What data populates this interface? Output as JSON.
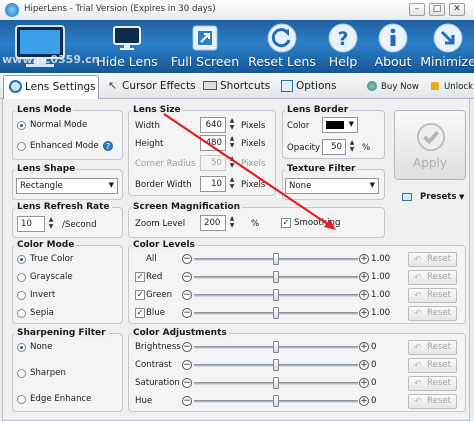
{
  "window": {
    "title": "HiperLens - Trial Version (Expires in 30 days)",
    "minimize": "–",
    "maximize": "□",
    "close": "✕"
  },
  "watermark": "www.pc0359.cn",
  "toolbar": {
    "hide_lens": "Hide Lens",
    "full_screen": "Full Screen",
    "reset_lens": "Reset Lens",
    "help": "Help",
    "about": "About",
    "minimize": "Minimize"
  },
  "tabs": {
    "lens_settings": "Lens Settings",
    "cursor_effects": "Cursor Effects",
    "shortcuts": "Shortcuts",
    "options": "Options",
    "buy_now": "Buy Now",
    "unlock": "Unlock"
  },
  "lens_mode": {
    "title": "Lens Mode",
    "normal": "Normal Mode",
    "enhanced": "Enhanced Mode",
    "selected": "normal"
  },
  "lens_size": {
    "title": "Lens Size",
    "width_label": "Width",
    "width_value": "640",
    "width_unit": "Pixels",
    "height_label": "Height",
    "height_value": "480",
    "height_unit": "Pixels",
    "corner_label": "Corner Radius",
    "corner_value": "50",
    "corner_unit": "Pixels",
    "border_label": "Border Width",
    "border_value": "10",
    "border_unit": "Pixels"
  },
  "lens_border": {
    "title": "Lens Border",
    "color_label": "Color",
    "color_value": "#000000",
    "opacity_label": "Opacity",
    "opacity_value": "50",
    "opacity_unit": "%"
  },
  "apply": {
    "label": "Apply"
  },
  "presets": {
    "label": "Presets"
  },
  "lens_shape": {
    "title": "Lens Shape",
    "value": "Rectangle"
  },
  "texture_filter": {
    "title": "Texture Filter",
    "value": "None"
  },
  "refresh_rate": {
    "title": "Lens Refresh Rate",
    "value": "10",
    "unit": "/Second"
  },
  "screen_mag": {
    "title": "Screen Magnification",
    "zoom_label": "Zoom Level",
    "zoom_value": "200",
    "zoom_unit": "%",
    "smoothing_label": "Smoothing",
    "smoothing_checked": true
  },
  "color_mode": {
    "title": "Color Mode",
    "items": [
      "True Color",
      "Grayscale",
      "Invert",
      "Sepia"
    ],
    "selected": 0
  },
  "color_levels": {
    "title": "Color Levels",
    "rows": [
      {
        "label": "All",
        "value": "1.00",
        "level": 0.5,
        "checkbox": false
      },
      {
        "label": "Red",
        "value": "1.00",
        "level": 0.5,
        "checkbox": true
      },
      {
        "label": "Green",
        "value": "1.00",
        "level": 0.5,
        "checkbox": true
      },
      {
        "label": "Blue",
        "value": "1.00",
        "level": 0.5,
        "checkbox": true
      }
    ],
    "reset_label": "Reset"
  },
  "sharpening": {
    "title": "Sharpening Filter",
    "items": [
      "None",
      "Sharpen",
      "Edge Enhance"
    ],
    "selected": 0
  },
  "color_adjust": {
    "title": "Color Adjustments",
    "rows": [
      {
        "label": "Brightness",
        "value": "0",
        "level": 0.5
      },
      {
        "label": "Contrast",
        "value": "0",
        "level": 0.5
      },
      {
        "label": "Saturation",
        "value": "0",
        "level": 0.5
      },
      {
        "label": "Hue",
        "value": "0",
        "level": 0.5
      }
    ],
    "reset_label": "Reset"
  },
  "symbols": {
    "minus": "−",
    "plus": "+",
    "help": "?"
  },
  "colors": {
    "toolbar": "#2a7fc8",
    "annotation_arrow": "#e02020"
  }
}
